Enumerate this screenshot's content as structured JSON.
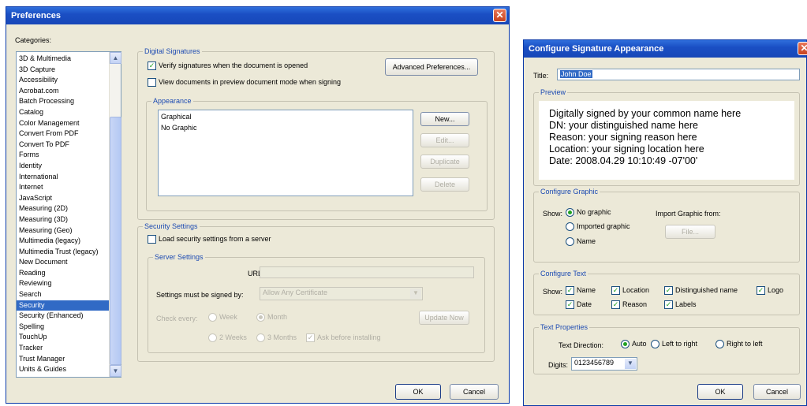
{
  "prefs": {
    "title": "Preferences",
    "categories_label": "Categories:",
    "categories": [
      "3D & Multimedia",
      "3D Capture",
      "Accessibility",
      "Acrobat.com",
      "Batch Processing",
      "Catalog",
      "Color Management",
      "Convert From PDF",
      "Convert To PDF",
      "Forms",
      "Identity",
      "International",
      "Internet",
      "JavaScript",
      "Measuring (2D)",
      "Measuring (3D)",
      "Measuring (Geo)",
      "Multimedia (legacy)",
      "Multimedia Trust (legacy)",
      "New Document",
      "Reading",
      "Reviewing",
      "Search",
      "Security",
      "Security (Enhanced)",
      "Spelling",
      "TouchUp",
      "Tracker",
      "Trust Manager",
      "Units & Guides"
    ],
    "selected_category": "Security",
    "digital_signatures_title": "Digital Signatures",
    "verify_label": "Verify signatures when the document is opened",
    "view_preview_label": "View documents in preview document mode when signing",
    "advanced_prefs_label": "Advanced Preferences...",
    "appearance_title": "Appearance",
    "appearances": [
      "Graphical",
      "No Graphic"
    ],
    "new_label": "New...",
    "edit_label": "Edit...",
    "duplicate_label": "Duplicate",
    "delete_label": "Delete",
    "security_settings_title": "Security Settings",
    "load_settings_label": "Load security settings from a server",
    "server_settings_title": "Server Settings",
    "url_label": "URL:",
    "url_value": "",
    "signed_by_label": "Settings must be signed by:",
    "signed_by_value": "Allow Any Certificate",
    "check_every_label": "Check every:",
    "week_label": "Week",
    "month_label": "Month",
    "two_weeks_label": "2 Weeks",
    "three_months_label": "3 Months",
    "ask_before_label": "Ask before installing",
    "update_now_label": "Update Now",
    "ok_label": "OK",
    "cancel_label": "Cancel"
  },
  "sig": {
    "title": "Configure Signature Appearance",
    "title_label": "Title:",
    "title_value": "John Doe",
    "preview_title": "Preview",
    "preview_lines": [
      "Digitally signed by your common name here",
      "DN: your distinguished name here",
      "Reason: your signing reason here",
      "Location: your signing location here",
      "Date: 2008.04.29 10:10:49 -07'00'"
    ],
    "configure_graphic_title": "Configure Graphic",
    "show_label": "Show:",
    "no_graphic_label": "No graphic",
    "imported_graphic_label": "Imported graphic",
    "name_label": "Name",
    "import_from_label": "Import Graphic from:",
    "file_label": "File...",
    "configure_text_title": "Configure Text",
    "text_show_label": "Show:",
    "text_opts": {
      "name": "Name",
      "location": "Location",
      "distinguished": "Distinguished name",
      "logo": "Logo",
      "date": "Date",
      "reason": "Reason",
      "labels": "Labels"
    },
    "text_properties_title": "Text Properties",
    "text_direction_label": "Text Direction:",
    "auto_label": "Auto",
    "ltr_label": "Left to right",
    "rtl_label": "Right to left",
    "digits_label": "Digits:",
    "digits_value": "0123456789",
    "ok_label": "OK",
    "cancel_label": "Cancel"
  },
  "colors": {
    "title_bar": "#1a4fc4",
    "dialog_bg": "#ece9d8",
    "selection": "#316ac5",
    "group_title": "#1d4bb2",
    "check": "#21a121"
  }
}
